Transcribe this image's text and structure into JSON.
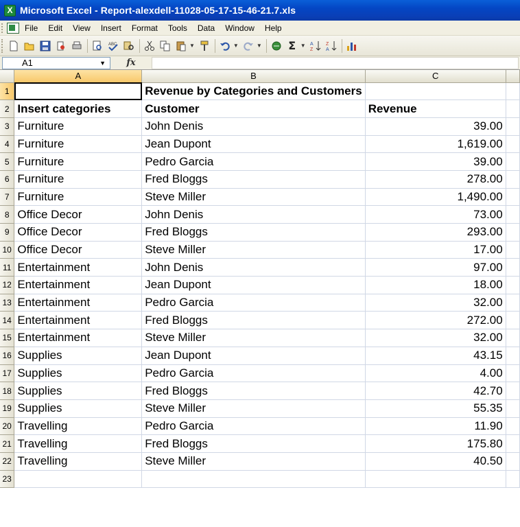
{
  "window": {
    "title": "Microsoft Excel - Report-alexdell-11028-05-17-15-46-21.7.xls",
    "app_icon_letter": "X"
  },
  "menu": [
    "File",
    "Edit",
    "View",
    "Insert",
    "Format",
    "Tools",
    "Data",
    "Window",
    "Help"
  ],
  "toolbar": {
    "icons": [
      "new-icon",
      "open-icon",
      "save-icon",
      "permission-icon",
      "print-icon",
      "print-preview-icon",
      "spelling-icon",
      "research-icon",
      "cut-icon",
      "copy-icon",
      "paste-icon",
      "format-painter-icon",
      "undo-icon",
      "redo-icon",
      "hyperlink-icon",
      "autosum-icon",
      "sort-ascending-icon",
      "sort-descending-icon",
      "chart-wizard-icon"
    ],
    "autosum_glyph": "Σ"
  },
  "formula_bar": {
    "name_box": "A1",
    "fx_label": "fx",
    "content": ""
  },
  "grid": {
    "columns": [
      "A",
      "B",
      "C"
    ],
    "row_numbers": [
      "1",
      "2",
      "3",
      "4",
      "5",
      "6",
      "7",
      "8",
      "9",
      "10",
      "11",
      "12",
      "13",
      "14",
      "15",
      "16",
      "17",
      "18",
      "19",
      "20",
      "21",
      "22",
      "23"
    ],
    "title": "Revenue by Categories and Customers",
    "headers": {
      "category": "Insert categories",
      "customer": "Customer",
      "revenue": "Revenue"
    },
    "rows": [
      {
        "category": "Furniture",
        "customer": "John Denis",
        "revenue": "39.00"
      },
      {
        "category": "Furniture",
        "customer": "Jean Dupont",
        "revenue": "1,619.00"
      },
      {
        "category": "Furniture",
        "customer": "Pedro Garcia",
        "revenue": "39.00"
      },
      {
        "category": "Furniture",
        "customer": "Fred Bloggs",
        "revenue": "278.00"
      },
      {
        "category": "Furniture",
        "customer": "Steve Miller",
        "revenue": "1,490.00"
      },
      {
        "category": "Office Decor",
        "customer": "John Denis",
        "revenue": "73.00"
      },
      {
        "category": "Office Decor",
        "customer": "Fred Bloggs",
        "revenue": "293.00"
      },
      {
        "category": "Office Decor",
        "customer": "Steve Miller",
        "revenue": "17.00"
      },
      {
        "category": "Entertainment",
        "customer": "John Denis",
        "revenue": "97.00"
      },
      {
        "category": "Entertainment",
        "customer": "Jean Dupont",
        "revenue": "18.00"
      },
      {
        "category": "Entertainment",
        "customer": "Pedro Garcia",
        "revenue": "32.00"
      },
      {
        "category": "Entertainment",
        "customer": "Fred Bloggs",
        "revenue": "272.00"
      },
      {
        "category": "Entertainment",
        "customer": "Steve Miller",
        "revenue": "32.00"
      },
      {
        "category": "Supplies",
        "customer": "Jean Dupont",
        "revenue": "43.15"
      },
      {
        "category": "Supplies",
        "customer": "Pedro Garcia",
        "revenue": "4.00"
      },
      {
        "category": "Supplies",
        "customer": "Fred Bloggs",
        "revenue": "42.70"
      },
      {
        "category": "Supplies",
        "customer": "Steve Miller",
        "revenue": "55.35"
      },
      {
        "category": "Travelling",
        "customer": "Pedro Garcia",
        "revenue": "11.90"
      },
      {
        "category": "Travelling",
        "customer": "Fred Bloggs",
        "revenue": "175.80"
      },
      {
        "category": "Travelling",
        "customer": "Steve Miller",
        "revenue": "40.50"
      }
    ]
  }
}
